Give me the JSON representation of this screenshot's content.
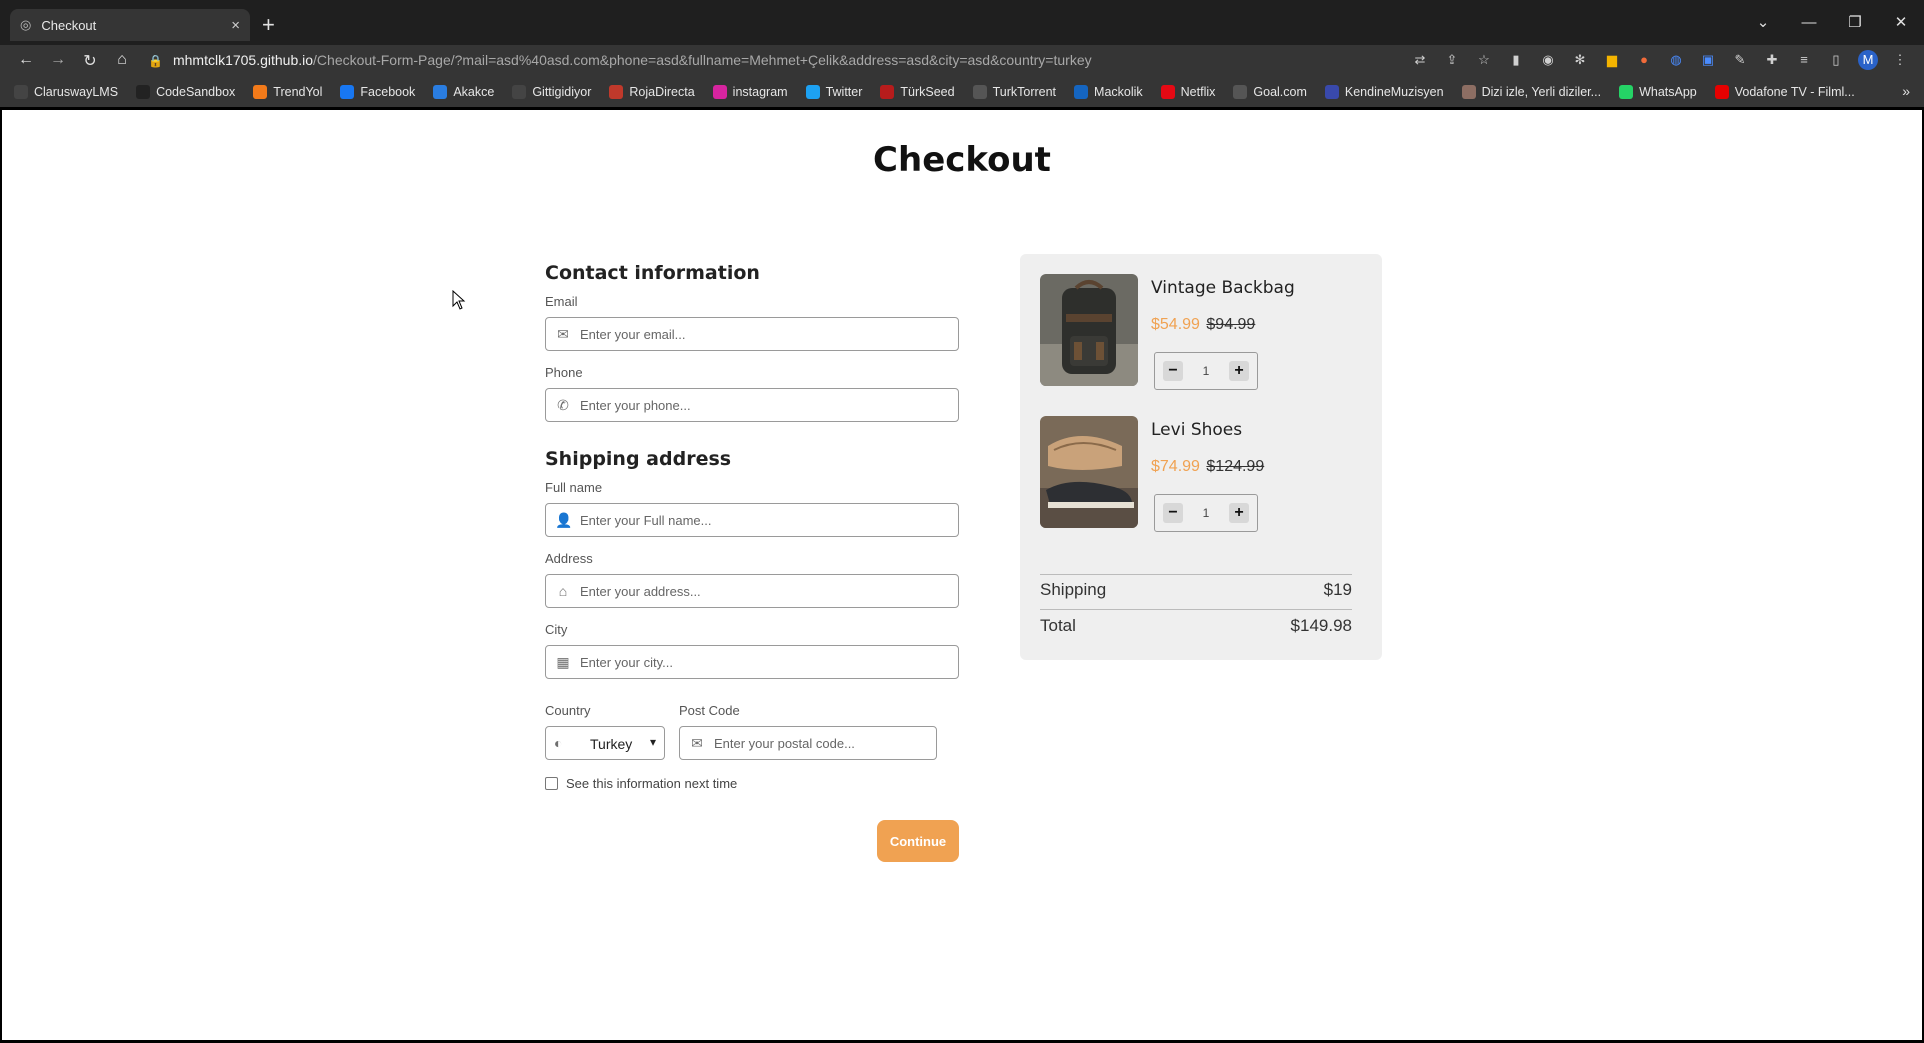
{
  "browser": {
    "tab_title": "Checkout",
    "tab_close": "×",
    "new_tab": "+",
    "url_host": "mhmtclk1705.github.io",
    "url_path": "/Checkout-Form-Page/?mail=asd%40asd.com&phone=asd&fullname=Mehmet+Çelik&address=asd&city=asd&country=turkey",
    "avatar_letter": "M",
    "bookmarks": [
      {
        "label": "ClaruswayLMS",
        "icon": "clarusway-icon",
        "color": "#444444"
      },
      {
        "label": "CodeSandbox",
        "icon": "codesandbox-icon",
        "color": "#222222"
      },
      {
        "label": "TrendYol",
        "icon": "trendyol-icon",
        "color": "#f27a1a"
      },
      {
        "label": "Facebook",
        "icon": "facebook-icon",
        "color": "#1877f2"
      },
      {
        "label": "Akakce",
        "icon": "akakce-icon",
        "color": "#2a7de1"
      },
      {
        "label": "Gittigidiyor",
        "icon": "gittigidiyor-icon",
        "color": "#444444"
      },
      {
        "label": "RojaDirecta",
        "icon": "rojadirecta-icon",
        "color": "#c0392b"
      },
      {
        "label": "instagram",
        "icon": "instagram-icon",
        "color": "#d6249f"
      },
      {
        "label": "Twitter",
        "icon": "twitter-icon",
        "color": "#1da1f2"
      },
      {
        "label": "TürkSeed",
        "icon": "turkseed-icon",
        "color": "#b71c1c"
      },
      {
        "label": "TurkTorrent",
        "icon": "turktorrent-icon",
        "color": "#555555"
      },
      {
        "label": "Mackolik",
        "icon": "mackolik-icon",
        "color": "#1565c0"
      },
      {
        "label": "Netflix",
        "icon": "netflix-icon",
        "color": "#e50914"
      },
      {
        "label": "Goal.com",
        "icon": "goal-icon",
        "color": "#555555"
      },
      {
        "label": "KendineMuzisyen",
        "icon": "kendinemuzisyen-icon",
        "color": "#3949ab"
      },
      {
        "label": "Dizi izle, Yerli diziler...",
        "icon": "dizi-icon",
        "color": "#8d6e63"
      },
      {
        "label": "WhatsApp",
        "icon": "whatsapp-icon",
        "color": "#25d366"
      },
      {
        "label": "Vodafone TV - Filml...",
        "icon": "vodafone-icon",
        "color": "#e60000"
      }
    ],
    "bookmarks_more": "»"
  },
  "page": {
    "title": "Checkout",
    "contact": {
      "heading": "Contact information",
      "email_label": "Email",
      "email_placeholder": "Enter your email...",
      "phone_label": "Phone",
      "phone_placeholder": "Enter your phone..."
    },
    "shipping": {
      "heading": "Shipping address",
      "fullname_label": "Full name",
      "fullname_placeholder": "Enter your Full name...",
      "address_label": "Address",
      "address_placeholder": "Enter your address...",
      "city_label": "City",
      "city_placeholder": "Enter your city...",
      "country_label": "Country",
      "country_value": "Turkey",
      "postcode_label": "Post Code",
      "postcode_placeholder": "Enter your postal code..."
    },
    "remember_label": "See this information next time",
    "continue_label": "Continue"
  },
  "cart": {
    "items": [
      {
        "name": "Vintage Backbag",
        "price": "$54.99",
        "old_price": "$94.99",
        "qty": "1"
      },
      {
        "name": "Levi Shoes",
        "price": "$74.99",
        "old_price": "$124.99",
        "qty": "1"
      }
    ],
    "shipping_label": "Shipping",
    "shipping_value": "$19",
    "total_label": "Total",
    "total_value": "$149.98",
    "accent": "#f0a252"
  }
}
